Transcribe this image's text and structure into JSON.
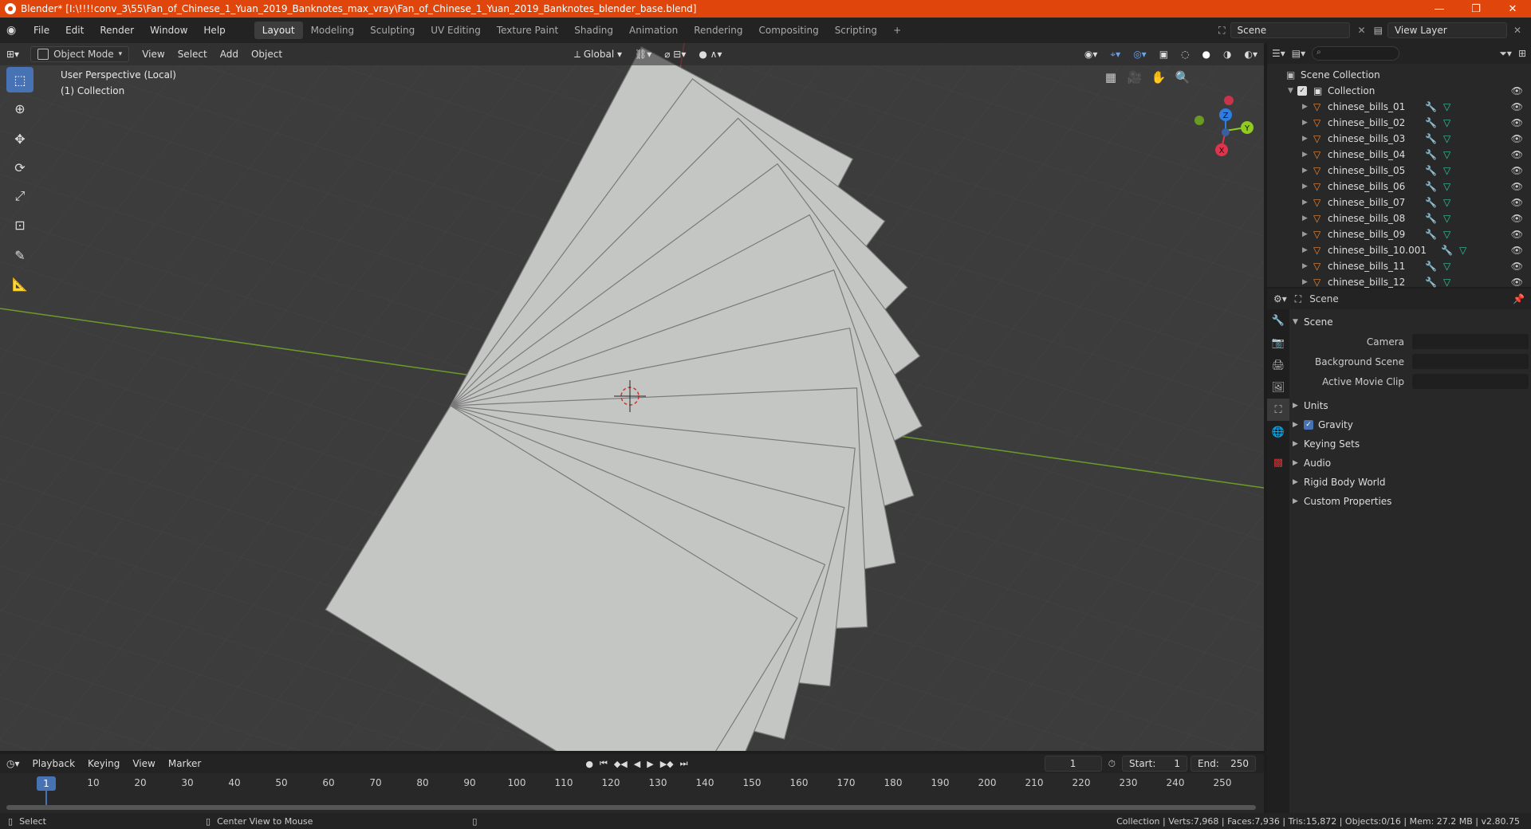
{
  "window": {
    "title": "Blender* [I:\\!!!!conv_3\\55\\Fan_of_Chinese_1_Yuan_2019_Banknotes_max_vray\\Fan_of_Chinese_1_Yuan_2019_Banknotes_blender_base.blend]"
  },
  "menus": [
    "File",
    "Edit",
    "Render",
    "Window",
    "Help"
  ],
  "workspaces": [
    "Layout",
    "Modeling",
    "Sculpting",
    "UV Editing",
    "Texture Paint",
    "Shading",
    "Animation",
    "Rendering",
    "Compositing",
    "Scripting"
  ],
  "scene_selector": "Scene",
  "view_layer": "View Layer",
  "viewport": {
    "mode": "Object Mode",
    "menus": [
      "View",
      "Select",
      "Add",
      "Object"
    ],
    "transform_orientation": "Global",
    "info_line1": "User Perspective (Local)",
    "info_line2": "(1) Collection",
    "gizmo": {
      "x": "X",
      "y": "Y",
      "z": "Z"
    },
    "colors": {
      "background": "#3c3c3c",
      "grid": "#444444",
      "x_axis": "#b84141",
      "y_axis": "#6c9b2a",
      "paper": "#c4c6c4",
      "paper_edge": "#7a7a7a"
    }
  },
  "outliner": {
    "scene_collection": "Scene Collection",
    "collection": "Collection",
    "objects": [
      "chinese_bills_01",
      "chinese_bills_02",
      "chinese_bills_03",
      "chinese_bills_04",
      "chinese_bills_05",
      "chinese_bills_06",
      "chinese_bills_07",
      "chinese_bills_08",
      "chinese_bills_09",
      "chinese_bills_10.001",
      "chinese_bills_11",
      "chinese_bills_12"
    ]
  },
  "properties": {
    "context": "Scene",
    "panel": "Scene",
    "fields": [
      {
        "label": "Camera"
      },
      {
        "label": "Background Scene"
      },
      {
        "label": "Active Movie Clip"
      }
    ],
    "sections": [
      "Units",
      "Gravity",
      "Keying Sets",
      "Audio",
      "Rigid Body World",
      "Custom Properties"
    ]
  },
  "timeline": {
    "menus": [
      "Playback",
      "Keying",
      "View",
      "Marker"
    ],
    "current_frame": "1",
    "start_label": "Start:",
    "start": "1",
    "end_label": "End:",
    "end": "250",
    "ticks": [
      "10",
      "20",
      "30",
      "40",
      "50",
      "60",
      "70",
      "80",
      "90",
      "100",
      "110",
      "120",
      "130",
      "140",
      "150",
      "160",
      "170",
      "180",
      "190",
      "200",
      "210",
      "220",
      "230",
      "240",
      "250"
    ]
  },
  "statusbar": {
    "left": "Select",
    "middle": "Center View to Mouse",
    "right": "Collection | Verts:7,968 | Faces:7,936 | Tris:15,872 | Objects:0/16 | Mem: 27.2 MB | v2.80.75"
  }
}
